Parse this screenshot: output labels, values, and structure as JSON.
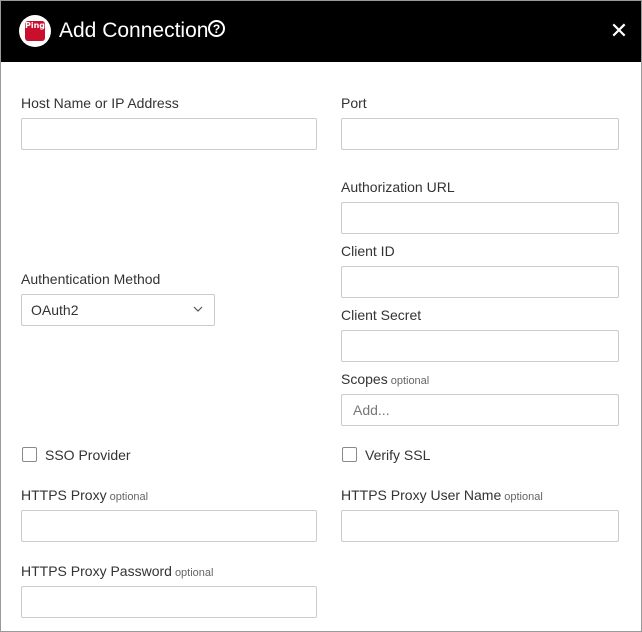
{
  "header": {
    "title": "Add Connection",
    "logo_text": "Ping",
    "help_symbol": "?",
    "close_symbol": "✕",
    "brand_color": "#c8102e"
  },
  "form": {
    "host": {
      "label": "Host Name or IP Address",
      "value": ""
    },
    "port": {
      "label": "Port",
      "value": ""
    },
    "authorization_url": {
      "label": "Authorization URL",
      "value": ""
    },
    "auth_method": {
      "label": "Authentication Method",
      "value": "OAuth2"
    },
    "client_id": {
      "label": "Client ID",
      "value": ""
    },
    "client_secret": {
      "label": "Client Secret",
      "value": ""
    },
    "scopes": {
      "label": "Scopes",
      "optional": "optional",
      "placeholder": "Add..."
    },
    "sso_provider": {
      "label": "SSO Provider",
      "checked": false
    },
    "verify_ssl": {
      "label": "Verify SSL",
      "checked": false
    },
    "https_proxy": {
      "label": "HTTPS Proxy",
      "optional": "optional",
      "value": ""
    },
    "https_proxy_user": {
      "label": "HTTPS Proxy User Name",
      "optional": "optional",
      "value": ""
    },
    "https_proxy_password": {
      "label": "HTTPS Proxy Password",
      "optional": "optional",
      "value": ""
    }
  }
}
